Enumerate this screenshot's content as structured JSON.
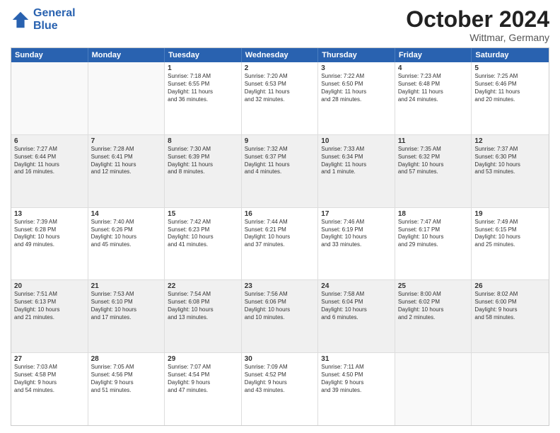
{
  "header": {
    "logo_line1": "General",
    "logo_line2": "Blue",
    "month": "October 2024",
    "location": "Wittmar, Germany"
  },
  "days": [
    "Sunday",
    "Monday",
    "Tuesday",
    "Wednesday",
    "Thursday",
    "Friday",
    "Saturday"
  ],
  "rows": [
    [
      {
        "day": "",
        "content": ""
      },
      {
        "day": "",
        "content": ""
      },
      {
        "day": "1",
        "content": "Sunrise: 7:18 AM\nSunset: 6:55 PM\nDaylight: 11 hours\nand 36 minutes."
      },
      {
        "day": "2",
        "content": "Sunrise: 7:20 AM\nSunset: 6:53 PM\nDaylight: 11 hours\nand 32 minutes."
      },
      {
        "day": "3",
        "content": "Sunrise: 7:22 AM\nSunset: 6:50 PM\nDaylight: 11 hours\nand 28 minutes."
      },
      {
        "day": "4",
        "content": "Sunrise: 7:23 AM\nSunset: 6:48 PM\nDaylight: 11 hours\nand 24 minutes."
      },
      {
        "day": "5",
        "content": "Sunrise: 7:25 AM\nSunset: 6:46 PM\nDaylight: 11 hours\nand 20 minutes."
      }
    ],
    [
      {
        "day": "6",
        "content": "Sunrise: 7:27 AM\nSunset: 6:44 PM\nDaylight: 11 hours\nand 16 minutes."
      },
      {
        "day": "7",
        "content": "Sunrise: 7:28 AM\nSunset: 6:41 PM\nDaylight: 11 hours\nand 12 minutes."
      },
      {
        "day": "8",
        "content": "Sunrise: 7:30 AM\nSunset: 6:39 PM\nDaylight: 11 hours\nand 8 minutes."
      },
      {
        "day": "9",
        "content": "Sunrise: 7:32 AM\nSunset: 6:37 PM\nDaylight: 11 hours\nand 4 minutes."
      },
      {
        "day": "10",
        "content": "Sunrise: 7:33 AM\nSunset: 6:34 PM\nDaylight: 11 hours\nand 1 minute."
      },
      {
        "day": "11",
        "content": "Sunrise: 7:35 AM\nSunset: 6:32 PM\nDaylight: 10 hours\nand 57 minutes."
      },
      {
        "day": "12",
        "content": "Sunrise: 7:37 AM\nSunset: 6:30 PM\nDaylight: 10 hours\nand 53 minutes."
      }
    ],
    [
      {
        "day": "13",
        "content": "Sunrise: 7:39 AM\nSunset: 6:28 PM\nDaylight: 10 hours\nand 49 minutes."
      },
      {
        "day": "14",
        "content": "Sunrise: 7:40 AM\nSunset: 6:26 PM\nDaylight: 10 hours\nand 45 minutes."
      },
      {
        "day": "15",
        "content": "Sunrise: 7:42 AM\nSunset: 6:23 PM\nDaylight: 10 hours\nand 41 minutes."
      },
      {
        "day": "16",
        "content": "Sunrise: 7:44 AM\nSunset: 6:21 PM\nDaylight: 10 hours\nand 37 minutes."
      },
      {
        "day": "17",
        "content": "Sunrise: 7:46 AM\nSunset: 6:19 PM\nDaylight: 10 hours\nand 33 minutes."
      },
      {
        "day": "18",
        "content": "Sunrise: 7:47 AM\nSunset: 6:17 PM\nDaylight: 10 hours\nand 29 minutes."
      },
      {
        "day": "19",
        "content": "Sunrise: 7:49 AM\nSunset: 6:15 PM\nDaylight: 10 hours\nand 25 minutes."
      }
    ],
    [
      {
        "day": "20",
        "content": "Sunrise: 7:51 AM\nSunset: 6:13 PM\nDaylight: 10 hours\nand 21 minutes."
      },
      {
        "day": "21",
        "content": "Sunrise: 7:53 AM\nSunset: 6:10 PM\nDaylight: 10 hours\nand 17 minutes."
      },
      {
        "day": "22",
        "content": "Sunrise: 7:54 AM\nSunset: 6:08 PM\nDaylight: 10 hours\nand 13 minutes."
      },
      {
        "day": "23",
        "content": "Sunrise: 7:56 AM\nSunset: 6:06 PM\nDaylight: 10 hours\nand 10 minutes."
      },
      {
        "day": "24",
        "content": "Sunrise: 7:58 AM\nSunset: 6:04 PM\nDaylight: 10 hours\nand 6 minutes."
      },
      {
        "day": "25",
        "content": "Sunrise: 8:00 AM\nSunset: 6:02 PM\nDaylight: 10 hours\nand 2 minutes."
      },
      {
        "day": "26",
        "content": "Sunrise: 8:02 AM\nSunset: 6:00 PM\nDaylight: 9 hours\nand 58 minutes."
      }
    ],
    [
      {
        "day": "27",
        "content": "Sunrise: 7:03 AM\nSunset: 4:58 PM\nDaylight: 9 hours\nand 54 minutes."
      },
      {
        "day": "28",
        "content": "Sunrise: 7:05 AM\nSunset: 4:56 PM\nDaylight: 9 hours\nand 51 minutes."
      },
      {
        "day": "29",
        "content": "Sunrise: 7:07 AM\nSunset: 4:54 PM\nDaylight: 9 hours\nand 47 minutes."
      },
      {
        "day": "30",
        "content": "Sunrise: 7:09 AM\nSunset: 4:52 PM\nDaylight: 9 hours\nand 43 minutes."
      },
      {
        "day": "31",
        "content": "Sunrise: 7:11 AM\nSunset: 4:50 PM\nDaylight: 9 hours\nand 39 minutes."
      },
      {
        "day": "",
        "content": ""
      },
      {
        "day": "",
        "content": ""
      }
    ]
  ]
}
